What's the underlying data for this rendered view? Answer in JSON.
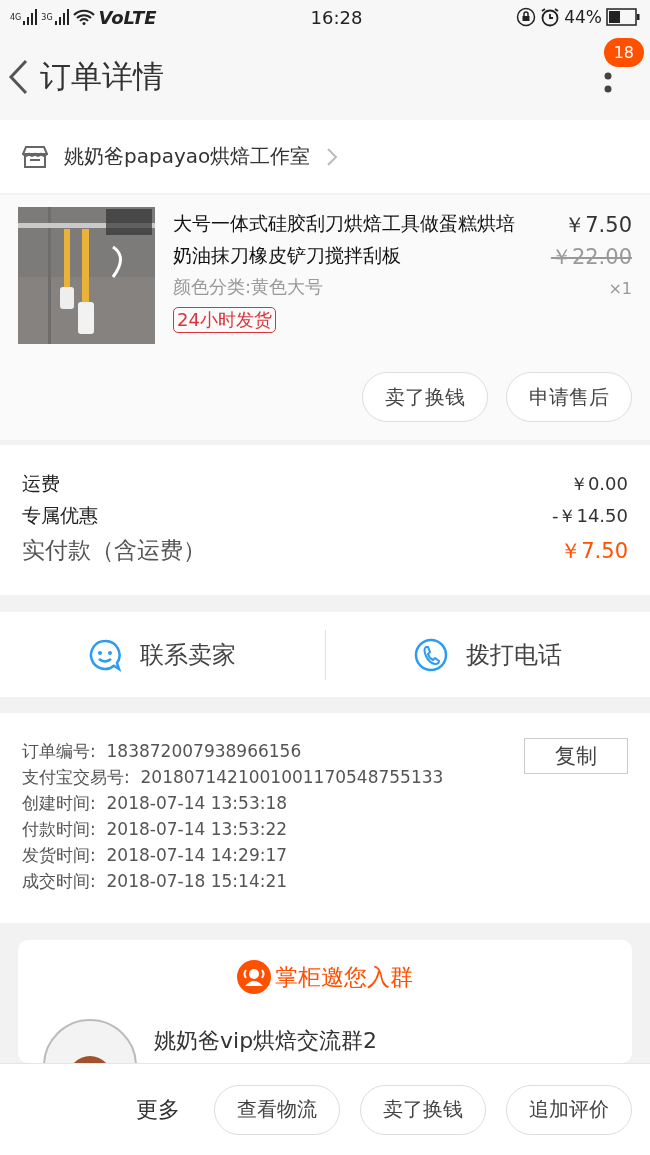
{
  "status_bar": {
    "network_1": "4G",
    "network_2": "3G",
    "volte": "VoLTE",
    "time": "16:28",
    "battery": "44%"
  },
  "header": {
    "title": "订单详情",
    "badge": "18"
  },
  "shop": {
    "name": "姚奶爸papayao烘焙工作室"
  },
  "item": {
    "title": "大号一体式硅胶刮刀烘焙工具做蛋糕烘培奶油抹刀橡皮铲刀搅拌刮板",
    "price": "￥7.50",
    "original_price": "￥22.00",
    "variant": "颜色分类:黄色大号",
    "quantity": "×1",
    "tag": "24小时发货",
    "actions": [
      "卖了换钱",
      "申请售后"
    ]
  },
  "summary": [
    {
      "label": "运费",
      "value": "￥0.00",
      "kind": "plain"
    },
    {
      "label": "专属优惠",
      "value": "-￥14.50",
      "kind": "plain"
    },
    {
      "label": "实付款（含运费）",
      "value": "￥7.50",
      "kind": "total"
    }
  ],
  "contact": [
    {
      "label": "联系卖家",
      "kind": "chat"
    },
    {
      "label": "拨打电话",
      "kind": "phone"
    }
  ],
  "order_info": {
    "copy_button": "复制",
    "rows": [
      {
        "label": "订单编号:",
        "value": "183872007938966156"
      },
      {
        "label": "支付宝交易号:",
        "value": "2018071421001001170548755133"
      },
      {
        "label": "创建时间:",
        "value": "2018-07-14 13:53:18"
      },
      {
        "label": "付款时间:",
        "value": "2018-07-14 13:53:22"
      },
      {
        "label": "发货时间:",
        "value": "2018-07-14 14:29:17"
      },
      {
        "label": "成交时间:",
        "value": "2018-07-18 15:14:21"
      }
    ]
  },
  "group_invite": {
    "title": "掌柜邀您入群",
    "group_name": "姚奶爸vip烘焙交流群2"
  },
  "bottom_bar": {
    "more": "更多",
    "buttons": [
      "查看物流",
      "卖了换钱",
      "追加评价"
    ]
  }
}
